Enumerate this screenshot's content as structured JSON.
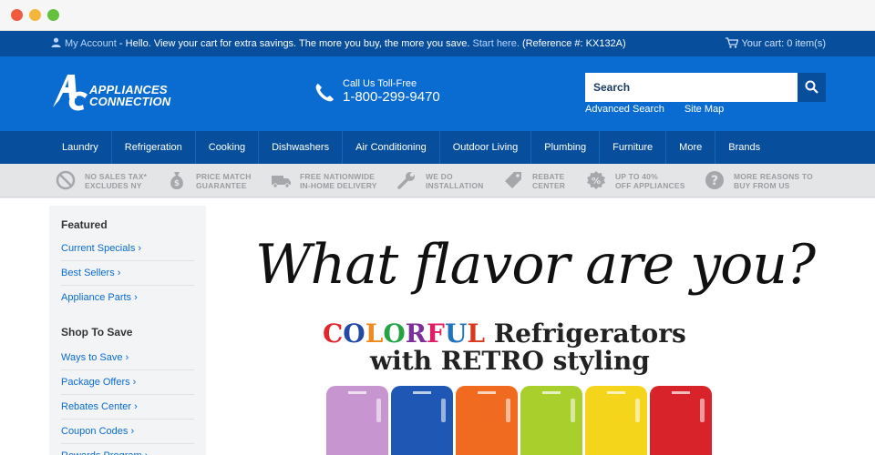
{
  "topbar": {
    "account": "My Account",
    "message": " - Hello. View your cart for extra savings. The more you buy, the more you save. ",
    "start_here": "Start here.",
    "reference": " (Reference #: KX132A)",
    "cart": "Your cart: 0 item(s)"
  },
  "header": {
    "logo_line1": "APPLIANCES",
    "logo_line2": "CONNECTION",
    "phone_label": "Call Us Toll-Free",
    "phone_number": "1-800-299-9470",
    "search_placeholder": "Search",
    "advanced_search": "Advanced Search",
    "site_map": "Site Map"
  },
  "nav": [
    "Laundry",
    "Refrigeration",
    "Cooking",
    "Dishwashers",
    "Air Conditioning",
    "Outdoor Living",
    "Plumbing",
    "Furniture",
    "More",
    "Brands"
  ],
  "benefits": [
    {
      "icon": "no-sign-icon",
      "text": "NO SALES TAX*\nEXCLUDES NY"
    },
    {
      "icon": "money-bag-icon",
      "text": "PRICE MATCH\nGUARANTEE"
    },
    {
      "icon": "truck-icon",
      "text": "FREE NATIONWIDE\nIN-HOME DELIVERY"
    },
    {
      "icon": "wrench-icon",
      "text": "WE DO\nINSTALLATION"
    },
    {
      "icon": "tag-icon",
      "text": "REBATE\nCENTER"
    },
    {
      "icon": "percent-icon",
      "text": "UP TO 40%\nOFF APPLIANCES"
    },
    {
      "icon": "question-icon",
      "text": "MORE REASONS TO\nBUY FROM US"
    }
  ],
  "sidebar": {
    "featured_title": "Featured",
    "featured": [
      "Current Specials",
      "Best Sellers",
      "Appliance Parts"
    ],
    "shop_title": "Shop To Save",
    "shop": [
      "Ways to Save",
      "Package Offers",
      "Rebates Center",
      "Coupon Codes",
      "Rewards Program"
    ]
  },
  "promo": {
    "title": "What flavor are you?",
    "colorful": [
      "C",
      "O",
      "L",
      "O",
      "R",
      "F",
      "U",
      "L"
    ],
    "sub1_rest": " Refrigerators",
    "sub2": "with RETRO styling"
  },
  "colors": {
    "topbar": "#074f9d",
    "header": "#0a6bd1",
    "fridges": [
      "#c795cf",
      "#1f57b4",
      "#f06a20",
      "#a8cf2b",
      "#f5d51c",
      "#d8232a"
    ]
  }
}
